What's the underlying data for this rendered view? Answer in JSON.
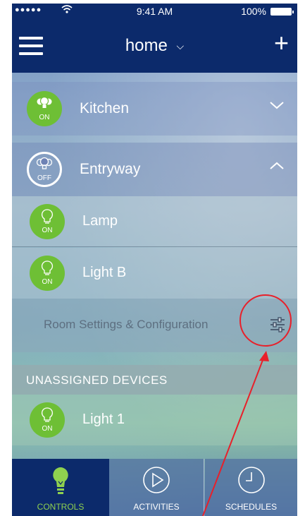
{
  "status_bar": {
    "signal": "●●●●●",
    "time": "9:41 AM",
    "battery": "100%"
  },
  "header": {
    "title": "home",
    "chevron": "⌵",
    "add_icon": "+"
  },
  "rooms": [
    {
      "name": "Kitchen",
      "state": "ON",
      "expanded": false
    },
    {
      "name": "Entryway",
      "state": "OFF",
      "expanded": true
    }
  ],
  "entryway_devices": [
    {
      "name": "Lamp",
      "state": "ON"
    },
    {
      "name": "Light B",
      "state": "ON"
    }
  ],
  "room_settings": {
    "label": "Room Settings & Configuration",
    "icon": "sliders-icon"
  },
  "unassigned": {
    "header": "UNASSIGNED DEVICES",
    "devices": [
      {
        "name": "Light 1",
        "state": "ON"
      }
    ]
  },
  "tabs": [
    {
      "label": "CONTROLS",
      "icon": "bulb-icon",
      "active": true
    },
    {
      "label": "ACTIVITIES",
      "icon": "play-icon",
      "active": false
    },
    {
      "label": "SCHEDULES",
      "icon": "clock-icon",
      "active": false
    }
  ],
  "colors": {
    "header_bg": "#0c2a6b",
    "on_green": "#6ebf35",
    "annotation_red": "#e8202a"
  }
}
